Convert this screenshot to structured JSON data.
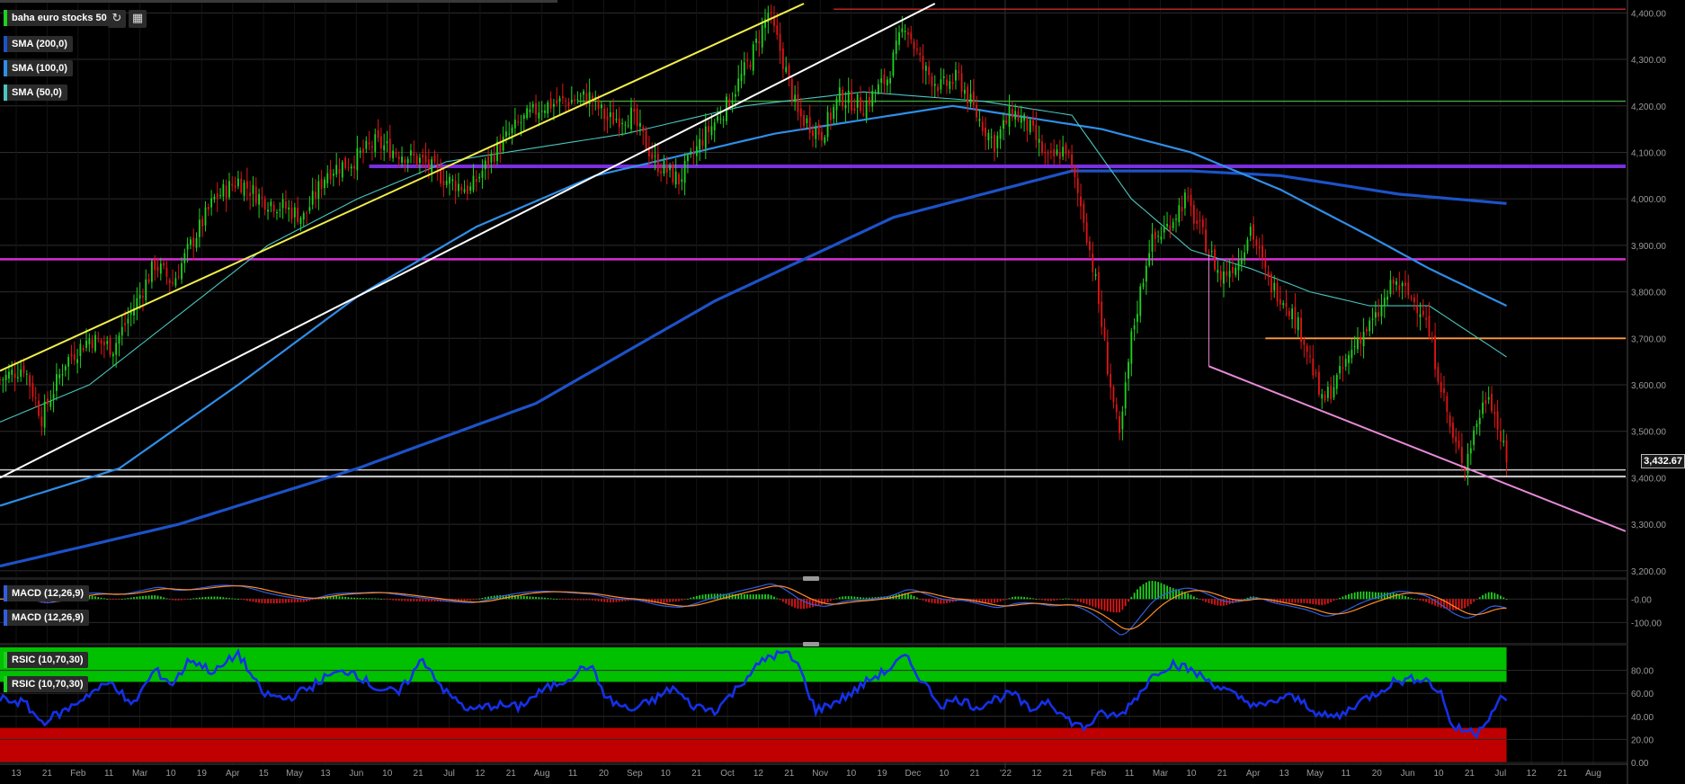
{
  "panels": {
    "price_label": "baha euro stocks 50",
    "sma200_label": "SMA (200,0)",
    "sma100_label": "SMA (100,0)",
    "sma50_label": "SMA (50,0)",
    "macd_label_1": "MACD (12,26,9)",
    "macd_label_2": "MACD (12,26,9)",
    "rsi_label_1": "RSIC (10,70,30)",
    "rsi_label_2": "RSIC (10,70,30)",
    "last_price": "3,432.67"
  },
  "toolbar": {
    "refresh_icon": "refresh-icon",
    "settings_icon": "indicator-settings-icon"
  },
  "colors": {
    "up_candle": "#1fd11f",
    "down_candle": "#e01515",
    "sma200": "#1d52c8",
    "sma100": "#2f8ee8",
    "sma50": "#49c6c0",
    "channel_upper": "#f2ee4a",
    "channel_lower": "#ffffff",
    "level_purple": "#7a2ee0",
    "level_magenta": "#d62ed6",
    "level_orange": "#ff9a3c",
    "level_green": "#3fa83f",
    "level_red": "#c82828",
    "trend_pink": "#e88ad8",
    "rsi_line": "#1530e8",
    "rsi_overbought_zone": "#00c000",
    "rsi_oversold_zone": "#c00000",
    "macd_line": "#2f5fe0",
    "signal_line": "#ff8c28"
  },
  "chart_data": [
    {
      "type": "candlestick",
      "title": "baha euro stocks 50",
      "x_tick_labels": [
        "13",
        "21",
        "Feb",
        "11",
        "Mar",
        "10",
        "19",
        "Apr",
        "15",
        "May",
        "13",
        "Jun",
        "10",
        "21",
        "Jul",
        "12",
        "21",
        "Aug",
        "11",
        "20",
        "Sep",
        "10",
        "21",
        "Oct",
        "12",
        "21",
        "Nov",
        "10",
        "19",
        "Dec",
        "10",
        "21",
        "'22",
        "12",
        "21",
        "Feb",
        "11",
        "Mar",
        "10",
        "21",
        "Apr",
        "13",
        "May",
        "11",
        "20",
        "Jun",
        "10",
        "21",
        "Jul",
        "12",
        "21",
        "Aug"
      ],
      "y_tick_labels": [
        "4,400.00",
        "4,300.00",
        "4,200.00",
        "4,100.00",
        "4,000.00",
        "3,900.00",
        "3,800.00",
        "3,700.00",
        "3,600.00",
        "3,500.00",
        "3,400.00",
        "3,300.00",
        "3,200.00"
      ],
      "ylim": [
        3190,
        4420
      ],
      "last_price": 3432.67,
      "close_anchors": [
        [
          0,
          3610
        ],
        [
          8,
          3640
        ],
        [
          14,
          3530
        ],
        [
          22,
          3650
        ],
        [
          30,
          3700
        ],
        [
          38,
          3680
        ],
        [
          46,
          3780
        ],
        [
          52,
          3860
        ],
        [
          58,
          3820
        ],
        [
          64,
          3900
        ],
        [
          72,
          4000
        ],
        [
          80,
          4040
        ],
        [
          88,
          4000
        ],
        [
          96,
          3980
        ],
        [
          102,
          3960
        ],
        [
          110,
          4060
        ],
        [
          118,
          4080
        ],
        [
          126,
          4120
        ],
        [
          134,
          4100
        ],
        [
          142,
          4080
        ],
        [
          150,
          4040
        ],
        [
          158,
          4020
        ],
        [
          166,
          4100
        ],
        [
          174,
          4160
        ],
        [
          182,
          4200
        ],
        [
          190,
          4210
        ],
        [
          198,
          4220
        ],
        [
          204,
          4170
        ],
        [
          212,
          4180
        ],
        [
          220,
          4080
        ],
        [
          228,
          4040
        ],
        [
          236,
          4130
        ],
        [
          244,
          4200
        ],
        [
          252,
          4300
        ],
        [
          258,
          4400
        ],
        [
          262,
          4320
        ],
        [
          268,
          4180
        ],
        [
          276,
          4140
        ],
        [
          282,
          4220
        ],
        [
          290,
          4200
        ],
        [
          298,
          4260
        ],
        [
          304,
          4380
        ],
        [
          310,
          4280
        ],
        [
          316,
          4240
        ],
        [
          322,
          4260
        ],
        [
          328,
          4180
        ],
        [
          334,
          4120
        ],
        [
          340,
          4190
        ],
        [
          346,
          4150
        ],
        [
          352,
          4080
        ],
        [
          358,
          4110
        ],
        [
          364,
          3960
        ],
        [
          368,
          3820
        ],
        [
          372,
          3640
        ],
        [
          376,
          3480
        ],
        [
          380,
          3700
        ],
        [
          386,
          3900
        ],
        [
          392,
          3940
        ],
        [
          398,
          4000
        ],
        [
          404,
          3920
        ],
        [
          410,
          3830
        ],
        [
          416,
          3870
        ],
        [
          420,
          3940
        ],
        [
          426,
          3820
        ],
        [
          432,
          3780
        ],
        [
          438,
          3700
        ],
        [
          444,
          3560
        ],
        [
          450,
          3620
        ],
        [
          456,
          3700
        ],
        [
          462,
          3740
        ],
        [
          468,
          3820
        ],
        [
          472,
          3800
        ],
        [
          478,
          3760
        ],
        [
          484,
          3600
        ],
        [
          488,
          3480
        ],
        [
          492,
          3430
        ],
        [
          496,
          3520
        ],
        [
          500,
          3590
        ],
        [
          506,
          3432.67
        ]
      ],
      "series": [
        {
          "name": "SMA (200,0)",
          "values": [
            [
              0,
              3210
            ],
            [
              60,
              3300
            ],
            [
              120,
              3420
            ],
            [
              180,
              3560
            ],
            [
              240,
              3780
            ],
            [
              300,
              3960
            ],
            [
              360,
              4060
            ],
            [
              400,
              4060
            ],
            [
              430,
              4050
            ],
            [
              470,
              4010
            ],
            [
              506,
              3990
            ]
          ]
        },
        {
          "name": "SMA (100,0)",
          "values": [
            [
              0,
              3340
            ],
            [
              40,
              3420
            ],
            [
              80,
              3600
            ],
            [
              120,
              3790
            ],
            [
              160,
              3940
            ],
            [
              200,
              4050
            ],
            [
              260,
              4140
            ],
            [
              320,
              4200
            ],
            [
              370,
              4150
            ],
            [
              400,
              4100
            ],
            [
              430,
              4020
            ],
            [
              460,
              3920
            ],
            [
              480,
              3850
            ],
            [
              506,
              3770
            ]
          ]
        },
        {
          "name": "SMA (50,0)",
          "values": [
            [
              0,
              3520
            ],
            [
              30,
              3600
            ],
            [
              60,
              3750
            ],
            [
              90,
              3900
            ],
            [
              120,
              4000
            ],
            [
              150,
              4080
            ],
            [
              180,
              4110
            ],
            [
              210,
              4140
            ],
            [
              250,
              4200
            ],
            [
              290,
              4230
            ],
            [
              330,
              4210
            ],
            [
              360,
              4180
            ],
            [
              380,
              4000
            ],
            [
              400,
              3890
            ],
            [
              420,
              3850
            ],
            [
              440,
              3800
            ],
            [
              460,
              3770
            ],
            [
              480,
              3770
            ],
            [
              506,
              3660
            ]
          ]
        }
      ],
      "annotations": {
        "horizontal_levels": [
          {
            "name": "purple",
            "value": 4070
          },
          {
            "name": "magenta",
            "value": 3870
          },
          {
            "name": "green",
            "value": 4210
          },
          {
            "name": "red-top",
            "value": 4408
          },
          {
            "name": "white-1",
            "value": 3403
          },
          {
            "name": "white-2",
            "value": 3417
          },
          {
            "name": "orange",
            "value": 3700
          }
        ],
        "trend_lines": [
          {
            "name": "upper-channel",
            "from": [
              0,
              3630
            ],
            "to": [
              270,
              4420
            ]
          },
          {
            "name": "lower-channel",
            "from": [
              0,
              3400
            ],
            "to": [
              314,
              4420
            ]
          },
          {
            "name": "pink-support",
            "from": [
              406,
              3640
            ],
            "to": [
              546,
              3285
            ]
          }
        ]
      }
    },
    {
      "type": "line",
      "title": "MACD (12,26,9)",
      "y_tick_labels": [
        "-0.00",
        "-100.00"
      ],
      "ylim": [
        -160,
        70
      ]
    },
    {
      "type": "line",
      "title": "RSIC (10,70,30)",
      "y_tick_labels": [
        "80.00",
        "60.00",
        "40.00",
        "20.00",
        "0.00"
      ],
      "ylim": [
        0,
        100
      ],
      "bands": {
        "overbought": [
          70,
          100
        ],
        "oversold": [
          0,
          30
        ]
      },
      "rsi_anchors": [
        [
          0,
          55
        ],
        [
          8,
          52
        ],
        [
          14,
          35
        ],
        [
          22,
          45
        ],
        [
          30,
          60
        ],
        [
          38,
          70
        ],
        [
          44,
          48
        ],
        [
          52,
          80
        ],
        [
          58,
          68
        ],
        [
          64,
          90
        ],
        [
          72,
          78
        ],
        [
          80,
          95
        ],
        [
          88,
          60
        ],
        [
          96,
          55
        ],
        [
          104,
          65
        ],
        [
          110,
          75
        ],
        [
          118,
          80
        ],
        [
          126,
          65
        ],
        [
          134,
          60
        ],
        [
          142,
          90
        ],
        [
          150,
          60
        ],
        [
          158,
          45
        ],
        [
          166,
          50
        ],
        [
          174,
          48
        ],
        [
          182,
          62
        ],
        [
          190,
          72
        ],
        [
          198,
          85
        ],
        [
          204,
          55
        ],
        [
          212,
          45
        ],
        [
          220,
          55
        ],
        [
          226,
          65
        ],
        [
          232,
          50
        ],
        [
          240,
          45
        ],
        [
          246,
          60
        ],
        [
          252,
          78
        ],
        [
          258,
          92
        ],
        [
          264,
          95
        ],
        [
          268,
          85
        ],
        [
          274,
          45
        ],
        [
          280,
          52
        ],
        [
          286,
          60
        ],
        [
          292,
          72
        ],
        [
          298,
          80
        ],
        [
          304,
          92
        ],
        [
          310,
          70
        ],
        [
          316,
          50
        ],
        [
          322,
          55
        ],
        [
          328,
          48
        ],
        [
          334,
          55
        ],
        [
          340,
          60
        ],
        [
          346,
          45
        ],
        [
          352,
          55
        ],
        [
          358,
          38
        ],
        [
          364,
          30
        ],
        [
          370,
          42
        ],
        [
          376,
          40
        ],
        [
          382,
          58
        ],
        [
          388,
          78
        ],
        [
          394,
          86
        ],
        [
          400,
          80
        ],
        [
          408,
          68
        ],
        [
          416,
          56
        ],
        [
          424,
          48
        ],
        [
          432,
          58
        ],
        [
          438,
          52
        ],
        [
          444,
          40
        ],
        [
          450,
          40
        ],
        [
          456,
          52
        ],
        [
          462,
          60
        ],
        [
          468,
          70
        ],
        [
          474,
          72
        ],
        [
          478,
          74
        ],
        [
          484,
          60
        ],
        [
          488,
          30
        ],
        [
          492,
          28
        ],
        [
          496,
          26
        ],
        [
          500,
          40
        ],
        [
          504,
          55
        ],
        [
          506,
          52
        ]
      ]
    }
  ]
}
